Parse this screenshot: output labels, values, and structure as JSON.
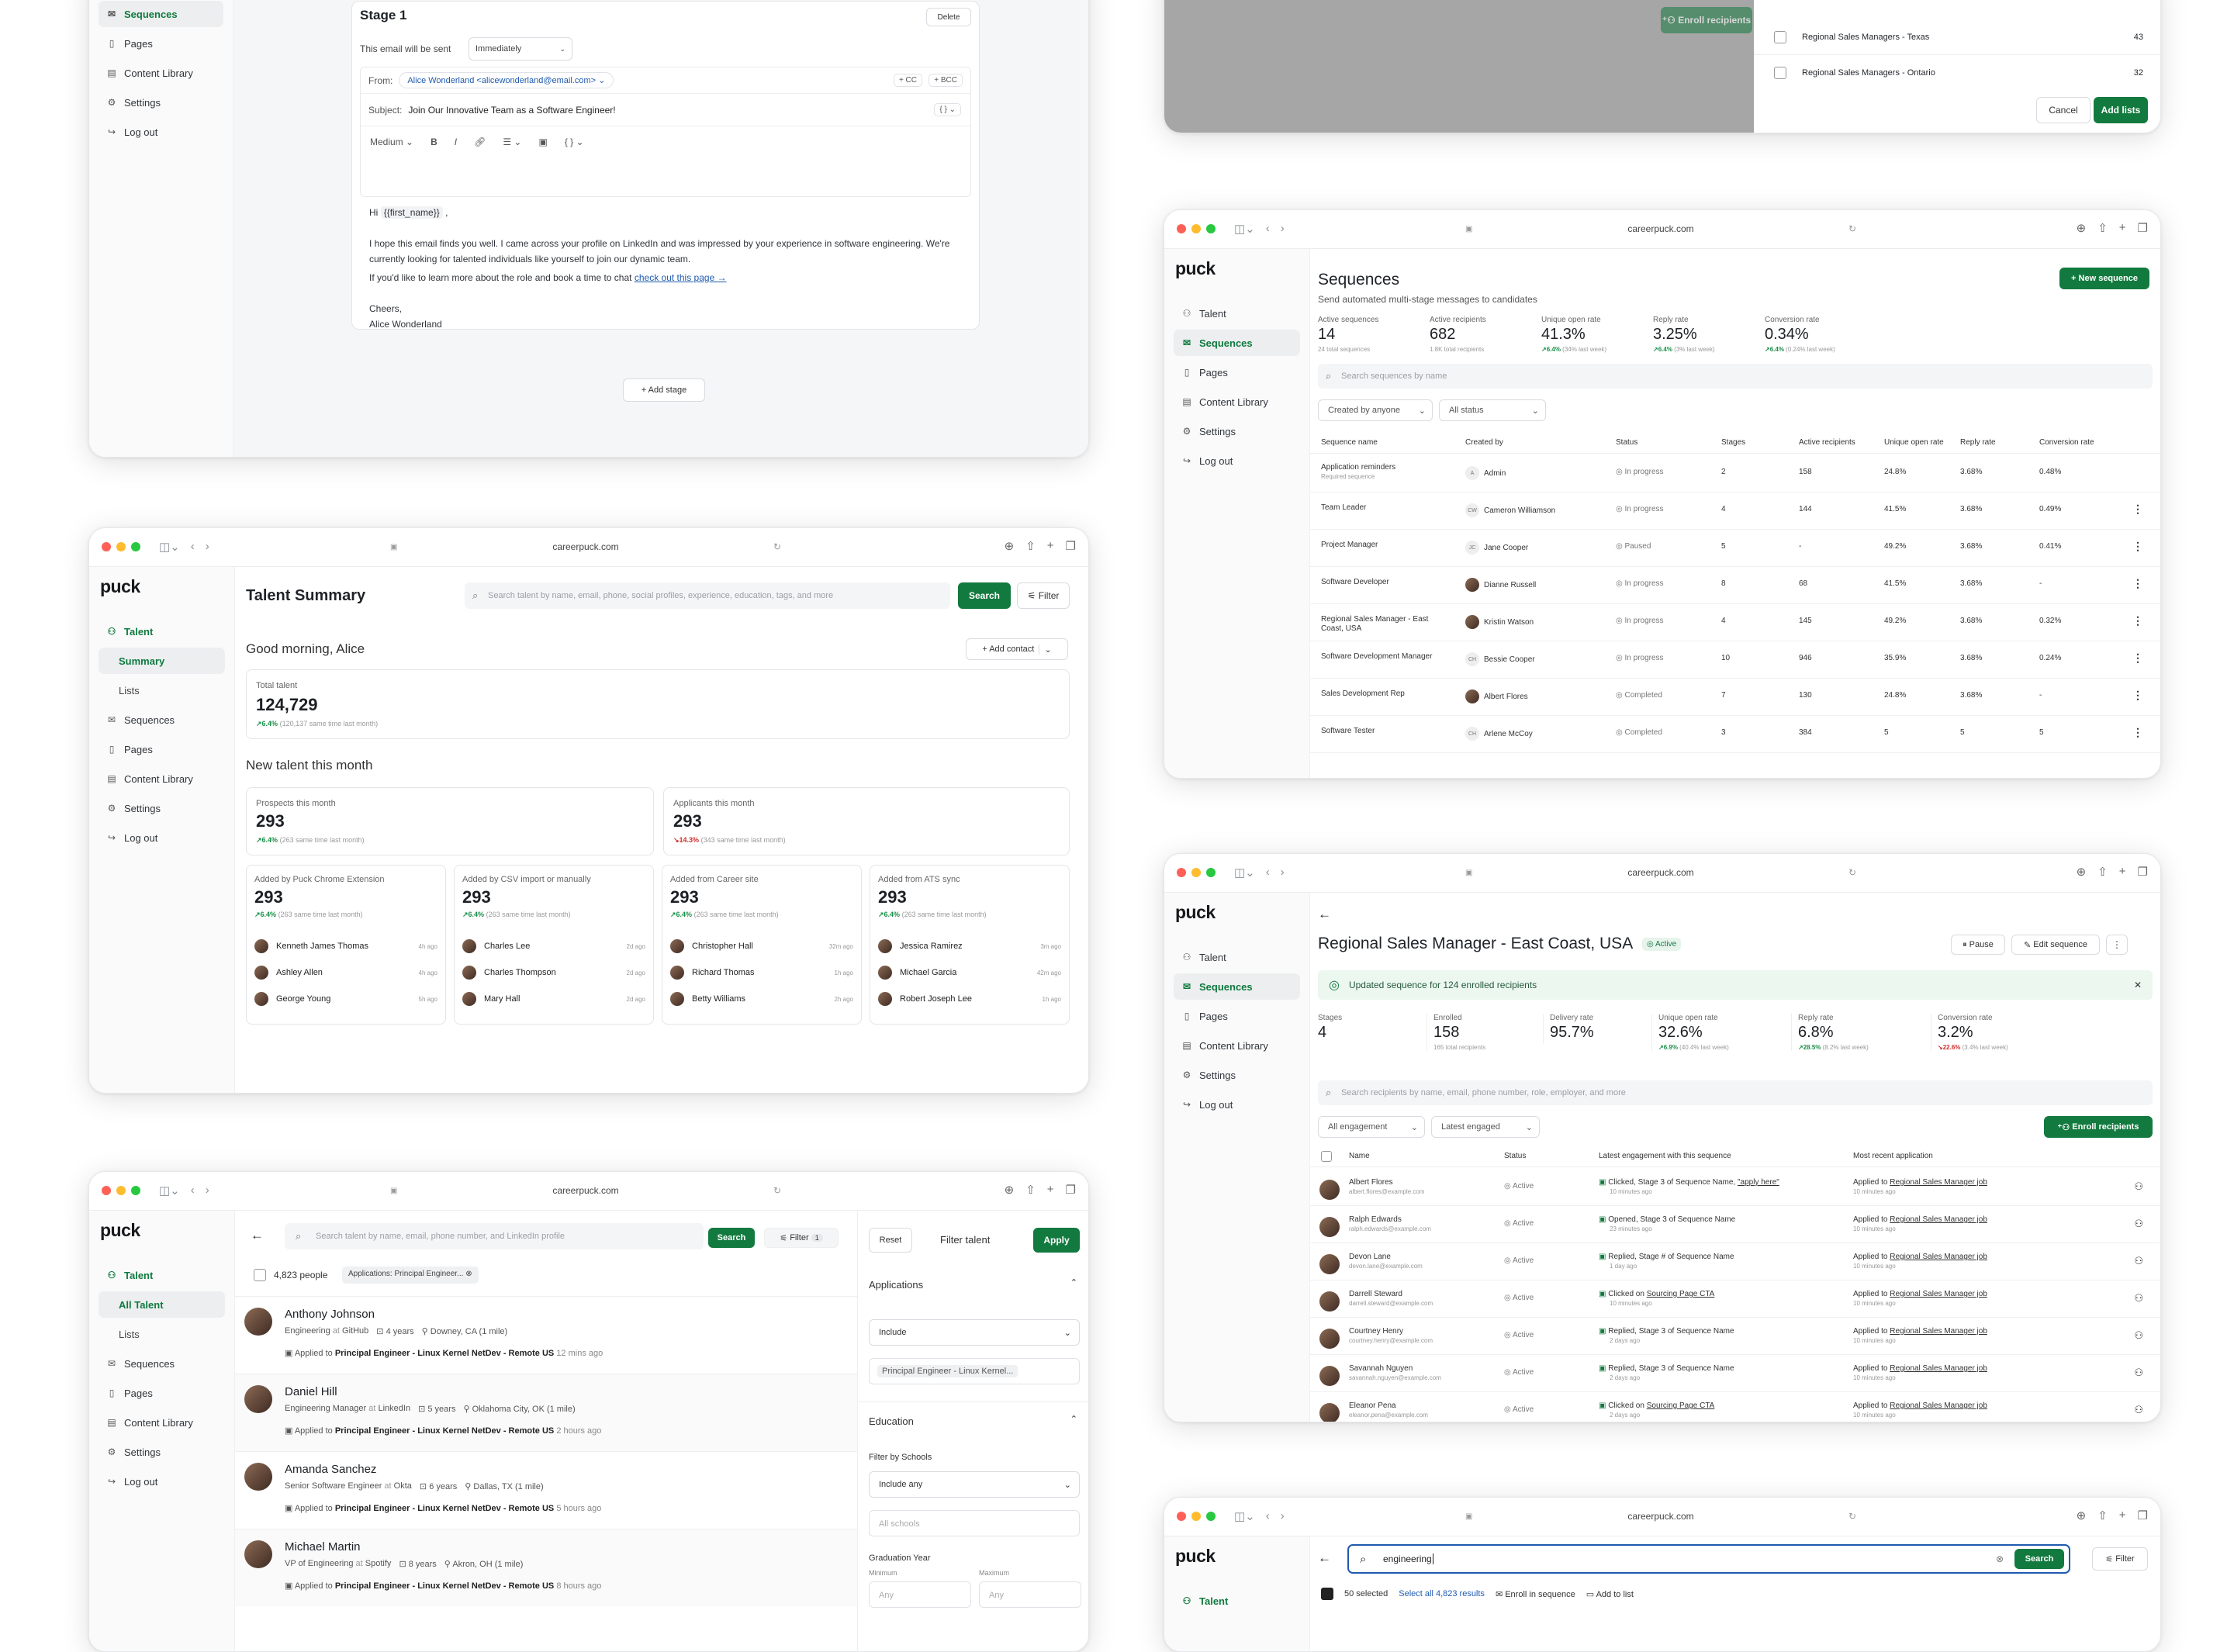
{
  "browser": {
    "url": "careerpuck.com"
  },
  "brand": {
    "logo": "puck",
    "accent": "#137a3f"
  },
  "nav": {
    "talent": "Talent",
    "summary": "Summary",
    "lists": "Lists",
    "all_talent": "All Talent",
    "sequences": "Sequences",
    "pages": "Pages",
    "content_library": "Content Library",
    "settings": "Settings",
    "logout": "Log out"
  },
  "editor": {
    "stage_title": "Stage 1",
    "delete": "Delete",
    "send_label": "This email will be sent",
    "send_value": "Immediately",
    "from_label": "From:",
    "from_value": "Alice Wonderland <alicewonderland@email.com>",
    "cc": "+ CC",
    "bcc": "+ BCC",
    "subject_label": "Subject:",
    "subject_value": "Join Our Innovative Team as a Software Engineer!",
    "font_size": "Medium",
    "body_greeting": "Hi",
    "body_var": "{{first_name}}",
    "body_comma": ",",
    "body_p1": "I hope this email finds you well. I came across your profile on LinkedIn and was impressed by your experience in software engineering. We're currently looking for talented individuals like yourself to join our dynamic team.",
    "body_p2": "If you'd like to learn more about the role and book a time to chat",
    "body_link": "check out this page →",
    "sign1": "Cheers,",
    "sign2": "Alice Wonderland",
    "add_stage": "+ Add stage"
  },
  "addlists": {
    "enroll": "Enroll recipients",
    "items": [
      {
        "name": "Regional Sales Managers - Texas",
        "count": "43"
      },
      {
        "name": "Regional Sales Managers - Ontario",
        "count": "32"
      }
    ],
    "cancel": "Cancel",
    "add": "Add lists"
  },
  "summary": {
    "title": "Talent Summary",
    "search_placeholder": "Search talent by name, email, phone, social profiles, experience, education, tags, and more",
    "search": "Search",
    "filter": "Filter",
    "greeting": "Good morning, Alice",
    "add_contact": "+ Add contact",
    "total_label": "Total talent",
    "total_value": "124,729",
    "total_delta": "↗6.4%",
    "total_delta_note": "(120,137 same time last month)",
    "new_title": "New talent this month",
    "prospects": {
      "label": "Prospects this month",
      "value": "293",
      "delta": "↗6.4%",
      "note": "(263 same time last month)"
    },
    "applicants": {
      "label": "Applicants this month",
      "value": "293",
      "delta": "↘14.3%",
      "note": "(343 same time last month)"
    },
    "sources": [
      {
        "label": "Added by Puck Chrome Extension",
        "value": "293",
        "delta": "↗6.4%",
        "note": "(263 same time last month)",
        "people": [
          {
            "n": "Kenneth James Thomas",
            "t": "4h ago"
          },
          {
            "n": "Ashley Allen",
            "t": "4h ago"
          },
          {
            "n": "George Young",
            "t": "5h ago"
          }
        ]
      },
      {
        "label": "Added by CSV import or manually",
        "value": "293",
        "delta": "↗6.4%",
        "note": "(263 same time last month)",
        "people": [
          {
            "n": "Charles Lee",
            "t": "2d ago"
          },
          {
            "n": "Charles Thompson",
            "t": "2d ago"
          },
          {
            "n": "Mary Hall",
            "t": "2d ago"
          }
        ]
      },
      {
        "label": "Added from Career site",
        "value": "293",
        "delta": "↗6.4%",
        "note": "(263 same time last month)",
        "people": [
          {
            "n": "Christopher Hall",
            "t": "32m ago"
          },
          {
            "n": "Richard Thomas",
            "t": "1h ago"
          },
          {
            "n": "Betty Williams",
            "t": "2h ago"
          }
        ]
      },
      {
        "label": "Added from ATS sync",
        "value": "293",
        "delta": "↗6.4%",
        "note": "(263 same time last month)",
        "people": [
          {
            "n": "Jessica Ramirez",
            "t": "3m ago"
          },
          {
            "n": "Michael Garcia",
            "t": "42m ago"
          },
          {
            "n": "Robert Joseph Lee",
            "t": "1h ago"
          }
        ]
      }
    ]
  },
  "talentlist": {
    "search_placeholder": "Search talent by name, email, phone number, and LinkedIn profile",
    "search": "Search",
    "filter": "Filter",
    "filter_count": "1",
    "count": "4,823 people",
    "chip": "Applications: Principal Engineer...",
    "people": [
      {
        "name": "Anthony Johnson",
        "role": "Engineering",
        "at": "at",
        "company": "GitHub",
        "yrs": "4 years",
        "loc": "Downey, CA (1 mile)",
        "applied": "Applied to",
        "job": "Principal Engineer - Linux Kernel NetDev - Remote US",
        "when": "12 mins ago"
      },
      {
        "name": "Daniel Hill",
        "role": "Engineering Manager",
        "at": "at",
        "company": "LinkedIn",
        "yrs": "5 years",
        "loc": "Oklahoma City, OK (1 mile)",
        "applied": "Applied to",
        "job": "Principal Engineer - Linux Kernel NetDev - Remote US",
        "when": "2 hours ago"
      },
      {
        "name": "Amanda Sanchez",
        "role": "Senior Software Engineer",
        "at": "at",
        "company": "Okta",
        "yrs": "6 years",
        "loc": "Dallas, TX (1 mile)",
        "applied": "Applied to",
        "job": "Principal Engineer - Linux Kernel NetDev - Remote US",
        "when": "5 hours ago"
      },
      {
        "name": "Michael Martin",
        "role": "VP of Engineering",
        "at": "at",
        "company": "Spotify",
        "yrs": "8 years",
        "loc": "Akron, OH (1 mile)",
        "applied": "Applied to",
        "job": "Principal Engineer - Linux Kernel NetDev - Remote US",
        "when": "8 hours ago"
      }
    ],
    "panel": {
      "reset": "Reset",
      "title": "Filter talent",
      "apply": "Apply",
      "applications": "Applications",
      "include": "Include",
      "job_chip": "Principal Engineer - Linux Kernel...",
      "education": "Education",
      "by_schools": "Filter by Schools",
      "include_any": "Include any",
      "all_schools": "All schools",
      "grad_year": "Graduation Year",
      "min": "Minimum",
      "max": "Maximum",
      "any1": "Any",
      "any2": "Any"
    }
  },
  "sequences": {
    "title": "Sequences",
    "subtitle": "Send automated multi-stage messages to candidates",
    "new": "+ New sequence",
    "stats": [
      {
        "label": "Active sequences",
        "value": "14",
        "note": "24 total sequences",
        "delta": ""
      },
      {
        "label": "Active recipients",
        "value": "682",
        "note": "1.8K total recipients",
        "delta": ""
      },
      {
        "label": "Unique open rate",
        "value": "41.3%",
        "delta": "↗6.4%",
        "note": "(34% last week)"
      },
      {
        "label": "Reply rate",
        "value": "3.25%",
        "delta": "↗6.4%",
        "note": "(3% last week)"
      },
      {
        "label": "Conversion rate",
        "value": "0.34%",
        "delta": "↗6.4%",
        "note": "(0.24% last week)"
      }
    ],
    "search_placeholder": "Search sequences by name",
    "created_filter": "Created by anyone",
    "status_filter": "All status",
    "headers": [
      "Sequence name",
      "Created by",
      "Status",
      "Stages",
      "Active recipients",
      "Unique open rate",
      "Reply rate",
      "Conversion rate"
    ],
    "rows": [
      {
        "name": "Application reminders",
        "sub": "Required sequence",
        "by": "Admin",
        "ini": "A",
        "status": "In progress",
        "stages": "2",
        "active": "158",
        "open": "24.8%",
        "reply": "3.68%",
        "conv": "0.48%",
        "photo": false
      },
      {
        "name": "Team Leader",
        "sub": "",
        "by": "Cameron Williamson",
        "ini": "CW",
        "status": "In progress",
        "stages": "4",
        "active": "144",
        "open": "41.5%",
        "reply": "3.68%",
        "conv": "0.49%",
        "photo": false
      },
      {
        "name": "Project Manager",
        "sub": "",
        "by": "Jane Cooper",
        "ini": "JC",
        "status": "Paused",
        "stages": "5",
        "active": "-",
        "open": "49.2%",
        "reply": "3.68%",
        "conv": "0.41%",
        "photo": false
      },
      {
        "name": "Software Developer",
        "sub": "",
        "by": "Dianne Russell",
        "ini": "",
        "status": "In progress",
        "stages": "8",
        "active": "68",
        "open": "41.5%",
        "reply": "3.68%",
        "conv": "-",
        "photo": true
      },
      {
        "name": "Regional Sales Manager - East Coast, USA",
        "sub": "",
        "by": "Kristin Watson",
        "ini": "",
        "status": "In progress",
        "stages": "4",
        "active": "145",
        "open": "49.2%",
        "reply": "3.68%",
        "conv": "0.32%",
        "photo": true
      },
      {
        "name": "Software Development Manager",
        "sub": "",
        "by": "Bessie Cooper",
        "ini": "CH",
        "status": "In progress",
        "stages": "10",
        "active": "946",
        "open": "35.9%",
        "reply": "3.68%",
        "conv": "0.24%",
        "photo": false
      },
      {
        "name": "Sales Development Rep",
        "sub": "",
        "by": "Albert Flores",
        "ini": "",
        "status": "Completed",
        "stages": "7",
        "active": "130",
        "open": "24.8%",
        "reply": "3.68%",
        "conv": "-",
        "photo": true
      },
      {
        "name": "Software Tester",
        "sub": "",
        "by": "Arlene McCoy",
        "ini": "CH",
        "status": "Completed",
        "stages": "3",
        "active": "384",
        "open": "5",
        "reply": "5",
        "conv": "5",
        "photo": false
      }
    ]
  },
  "detail": {
    "title": "Regional Sales Manager - East Coast, USA",
    "badge": "Active",
    "pause": "Pause",
    "edit": "Edit sequence",
    "banner": "Updated sequence for 124 enrolled recipients",
    "stats": [
      {
        "label": "Stages",
        "value": "4",
        "delta": "",
        "note": ""
      },
      {
        "label": "Enrolled",
        "value": "158",
        "delta": "",
        "note": "165 total recipients"
      },
      {
        "label": "Delivery rate",
        "value": "95.7%",
        "delta": "",
        "note": ""
      },
      {
        "label": "Unique open rate",
        "value": "32.6%",
        "delta": "↗6.9%",
        "note": "(40.4% last week)"
      },
      {
        "label": "Reply rate",
        "value": "6.8%",
        "delta": "↗28.5%",
        "note": "(8.2% last week)"
      },
      {
        "label": "Conversion rate",
        "value": "3.2%",
        "delta": "↘22.6%",
        "note": "(3.4% last week)"
      }
    ],
    "search_placeholder": "Search recipients by name, email, phone number, role, employer, and more",
    "eng_filter": "All engagement",
    "sort": "Latest engaged",
    "enroll": "Enroll recipients",
    "headers": [
      "Name",
      "Status",
      "Latest engagement with this sequence",
      "Most recent application"
    ],
    "rows": [
      {
        "n": "Albert Flores",
        "e": "albert.flores@example.com",
        "eng": "Clicked, Stage 3 of Sequence Name,",
        "eng2": "\"apply here\"",
        "when": "10 minutes ago",
        "app": "Applied to",
        "job": "Regional Sales Manager job",
        "aw": "10 minutes ago"
      },
      {
        "n": "Ralph Edwards",
        "e": "ralph.edwards@example.com",
        "eng": "Opened, Stage 3 of Sequence Name",
        "eng2": "",
        "when": "23 minutes ago",
        "app": "Applied to",
        "job": "Regional Sales Manager job",
        "aw": "10 minutes ago"
      },
      {
        "n": "Devon Lane",
        "e": "devon.lane@example.com",
        "eng": "Replied, Stage # of Sequence Name",
        "eng2": "",
        "when": "1 day ago",
        "app": "Applied to",
        "job": "Regional Sales Manager job",
        "aw": "10 minutes ago"
      },
      {
        "n": "Darrell Steward",
        "e": "darrell.steward@example.com",
        "eng": "Clicked on",
        "eng2": "Sourcing Page CTA",
        "when": "10 minutes ago",
        "app": "Applied to",
        "job": "Regional Sales Manager job",
        "aw": "10 minutes ago"
      },
      {
        "n": "Courtney Henry",
        "e": "courtney.henry@example.com",
        "eng": "Replied, Stage 3 of Sequence Name",
        "eng2": "",
        "when": "2 days ago",
        "app": "Applied to",
        "job": "Regional Sales Manager job",
        "aw": "10 minutes ago"
      },
      {
        "n": "Savannah Nguyen",
        "e": "savannah.nguyen@example.com",
        "eng": "Replied, Stage 3 of Sequence Name",
        "eng2": "",
        "when": "2 days ago",
        "app": "Applied to",
        "job": "Regional Sales Manager job",
        "aw": "10 minutes ago"
      },
      {
        "n": "Eleanor Pena",
        "e": "eleanor.pena@example.com",
        "eng": "Clicked on",
        "eng2": "Sourcing Page CTA",
        "when": "2 days ago",
        "app": "Applied to",
        "job": "Regional Sales Manager job",
        "aw": "10 minutes ago"
      }
    ],
    "status": "Active"
  },
  "bulk": {
    "query": "engineering",
    "search": "Search",
    "filter": "Filter",
    "selected": "50 selected",
    "select_all": "Select all 4,823 results",
    "enroll": "Enroll in sequence",
    "add_list": "Add to list"
  }
}
